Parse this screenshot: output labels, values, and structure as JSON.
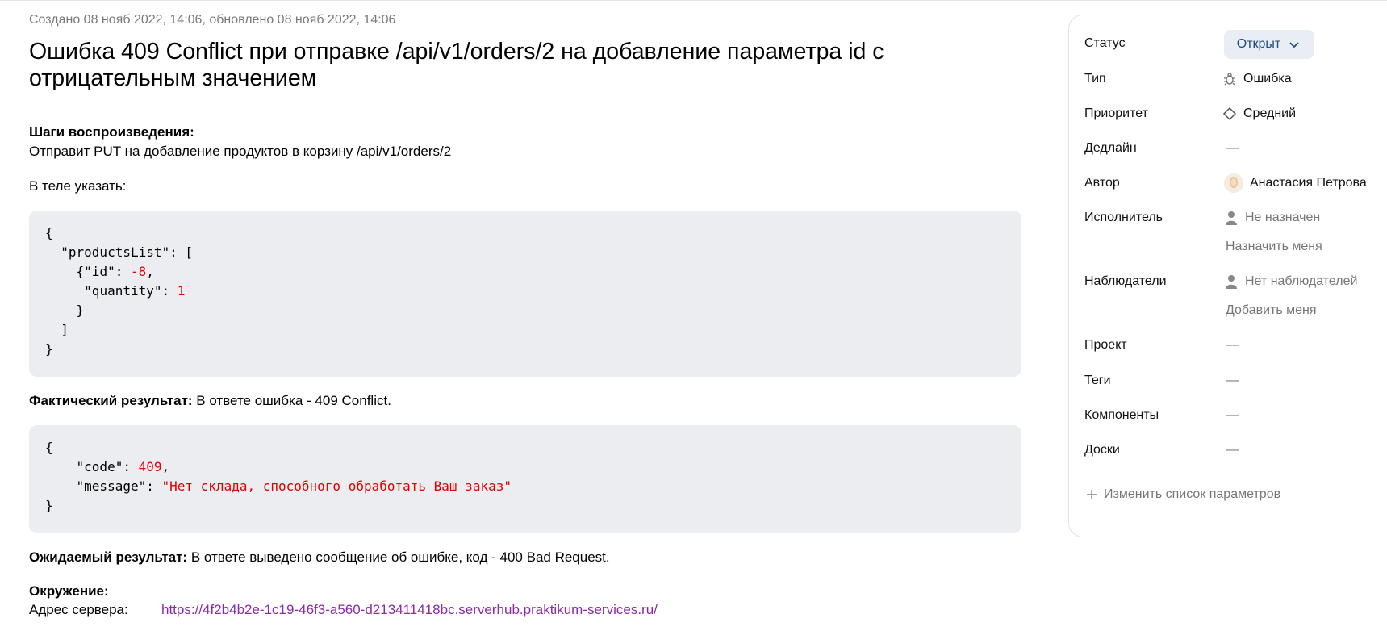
{
  "issue": {
    "meta": "Создано 08 нояб 2022, 14:06, обновлено 08 нояб 2022, 14:06",
    "title": "Ошибка 409 Conflict при отправке /api/v1/orders/2 на добавление параметра id с отрицательным значением"
  },
  "description": {
    "steps_heading": "Шаги воспроизведения:",
    "steps_text": "Отправит PUT на добавление продуктов в корзину /api/v1/orders/2",
    "body_hint": "В теле указать:",
    "code1": {
      "l1": "{",
      "key_products": "\"productsList\"",
      "key_id": "\"id\"",
      "id_value": "-8",
      "key_quantity": "\"quantity\"",
      "quantity_value": "1",
      "close_obj": "}",
      "close_arr": "]",
      "close": "}"
    },
    "actual_label": "Фактический результат:",
    "actual_text": " В ответе ошибка - 409 Conflict.",
    "code2": {
      "l1": "{",
      "key_code": "\"code\"",
      "code_value": "409",
      "key_message": "\"message\"",
      "message_value": "\"Нет склада, способного обработать Ваш заказ\"",
      "close": "}"
    },
    "expected_label": "Ожидаемый результат:",
    "expected_text": " В ответе выведено сообщение об ошибке, код - 400 Bad Request.",
    "env_heading": "Окружение:",
    "server_label": "Адрес сервера:",
    "server_url": "https://4f2b4b2e-1c19-46f3-a560-d213411418bc.serverhub.praktikum-services.ru/"
  },
  "sidebar": {
    "status_label": "Статус",
    "status_value": "Открыт",
    "type_label": "Тип",
    "type_value": "Ошибка",
    "priority_label": "Приоритет",
    "priority_value": "Средний",
    "deadline_label": "Дедлайн",
    "deadline_value": "—",
    "author_label": "Автор",
    "author_value": "Анастасия Петрова",
    "assignee_label": "Исполнитель",
    "assignee_value": "Не назначен",
    "assign_me": "Назначить меня",
    "watchers_label": "Наблюдатели",
    "watchers_value": "Нет наблюдателей",
    "add_me": "Добавить меня",
    "project_label": "Проект",
    "project_value": "—",
    "tags_label": "Теги",
    "tags_value": "—",
    "components_label": "Компоненты",
    "components_value": "—",
    "boards_label": "Доски",
    "boards_value": "—",
    "change_params": "Изменить список параметров"
  },
  "colors": {
    "code_bg": "#ebedf0",
    "code_value": "#e00000",
    "link": "#8a2ca8",
    "status_bg": "#e9eef5",
    "status_text": "#1f4b80"
  }
}
